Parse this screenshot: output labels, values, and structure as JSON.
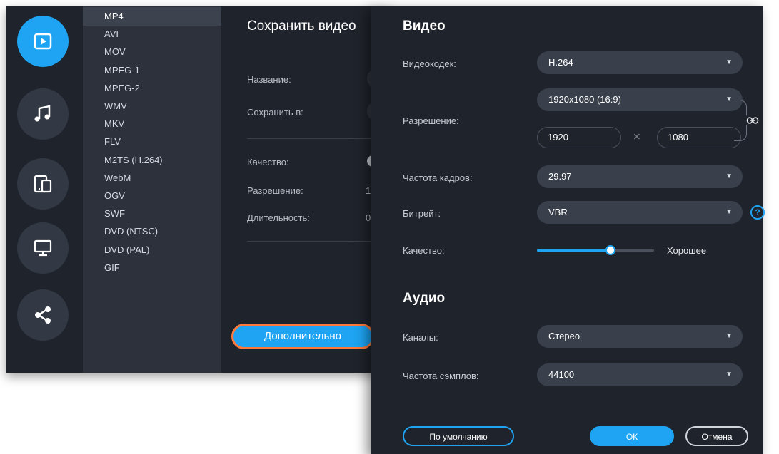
{
  "rail": {
    "icons": [
      "video-icon",
      "music-icon",
      "devices-icon",
      "monitor-icon",
      "share-icon"
    ],
    "active": "video-icon",
    "accent": "#1ea4f2"
  },
  "formats": {
    "items": [
      "MP4",
      "AVI",
      "MOV",
      "MPEG-1",
      "MPEG-2",
      "WMV",
      "MKV",
      "FLV",
      "M2TS (H.264)",
      "WebM",
      "OGV",
      "SWF",
      "DVD (NTSC)",
      "DVD (PAL)",
      "GIF"
    ],
    "selected": "MP4"
  },
  "save_panel": {
    "title": "Сохранить видео",
    "name_label": "Название:",
    "save_to_label": "Сохранить в:",
    "quality_label": "Качество:",
    "resolution_label": "Разрешение:",
    "resolution_value": "1",
    "duration_label": "Длительность:",
    "duration_value": "0",
    "advanced_button": "Дополнительно",
    "highlight_color": "#ff7a3a"
  },
  "dialog": {
    "video_title": "Видео",
    "codec_label": "Видеокодек:",
    "codec_value": "H.264",
    "resolution_label": "Разрешение:",
    "resolution_value": "1920x1080 (16:9)",
    "width_value": "1920",
    "times_sign": "×",
    "height_value": "1080",
    "framerate_label": "Частота кадров:",
    "framerate_value": "29.97",
    "bitrate_label": "Битрейт:",
    "bitrate_value": "VBR",
    "help_icon": "?",
    "quality_label": "Качество:",
    "quality_value": "Хорошее",
    "quality_level": 0.62,
    "audio_title": "Аудио",
    "channels_label": "Каналы:",
    "channels_value": "Стерео",
    "samplerate_label": "Частота сэмплов:",
    "samplerate_value": "44100",
    "default_button": "По умолчанию",
    "ok_button": "ОК",
    "cancel_button": "Отмена"
  }
}
